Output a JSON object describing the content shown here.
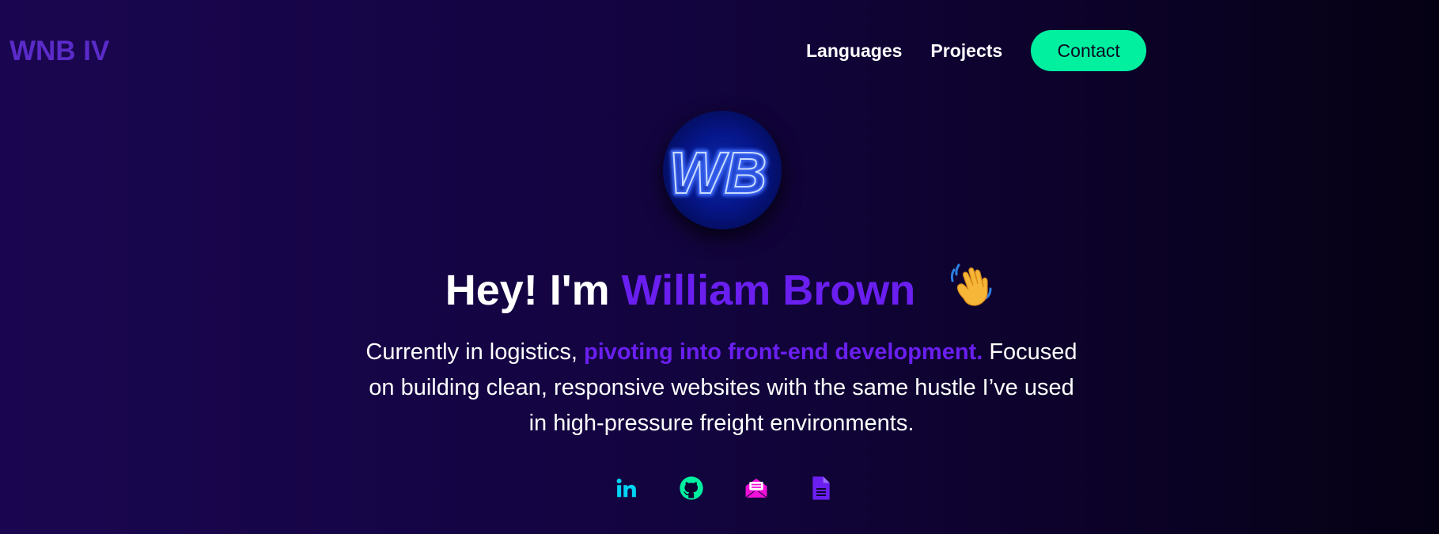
{
  "brand": {
    "logo_text": "WNB IV"
  },
  "nav": {
    "links": [
      "Languages",
      "Projects"
    ],
    "contact_label": "Contact"
  },
  "avatar": {
    "monogram": "WB"
  },
  "hero": {
    "greeting": "Hey! I'm",
    "name": "William Brown",
    "wave_icon": "waving-hand-icon"
  },
  "bio": {
    "part1": "Currently in logistics, ",
    "highlight": "pivoting into front-end development.",
    "part2": " Focused on building clean, responsive websites with the same hustle I’ve used in high-pressure freight environments."
  },
  "socials": [
    {
      "icon": "linkedin-icon",
      "color": "#00d4f5"
    },
    {
      "icon": "github-icon",
      "color": "#00f0a0"
    },
    {
      "icon": "email-icon",
      "color": "#f010d8"
    },
    {
      "icon": "resume-document-icon",
      "color": "#6a1ff0"
    }
  ],
  "colors": {
    "accent_purple": "#6a1ff0",
    "logo_purple": "#5b2bc9",
    "contact_green": "#00f0a0",
    "background_start": "#1a0650",
    "background_end": "#050113"
  }
}
